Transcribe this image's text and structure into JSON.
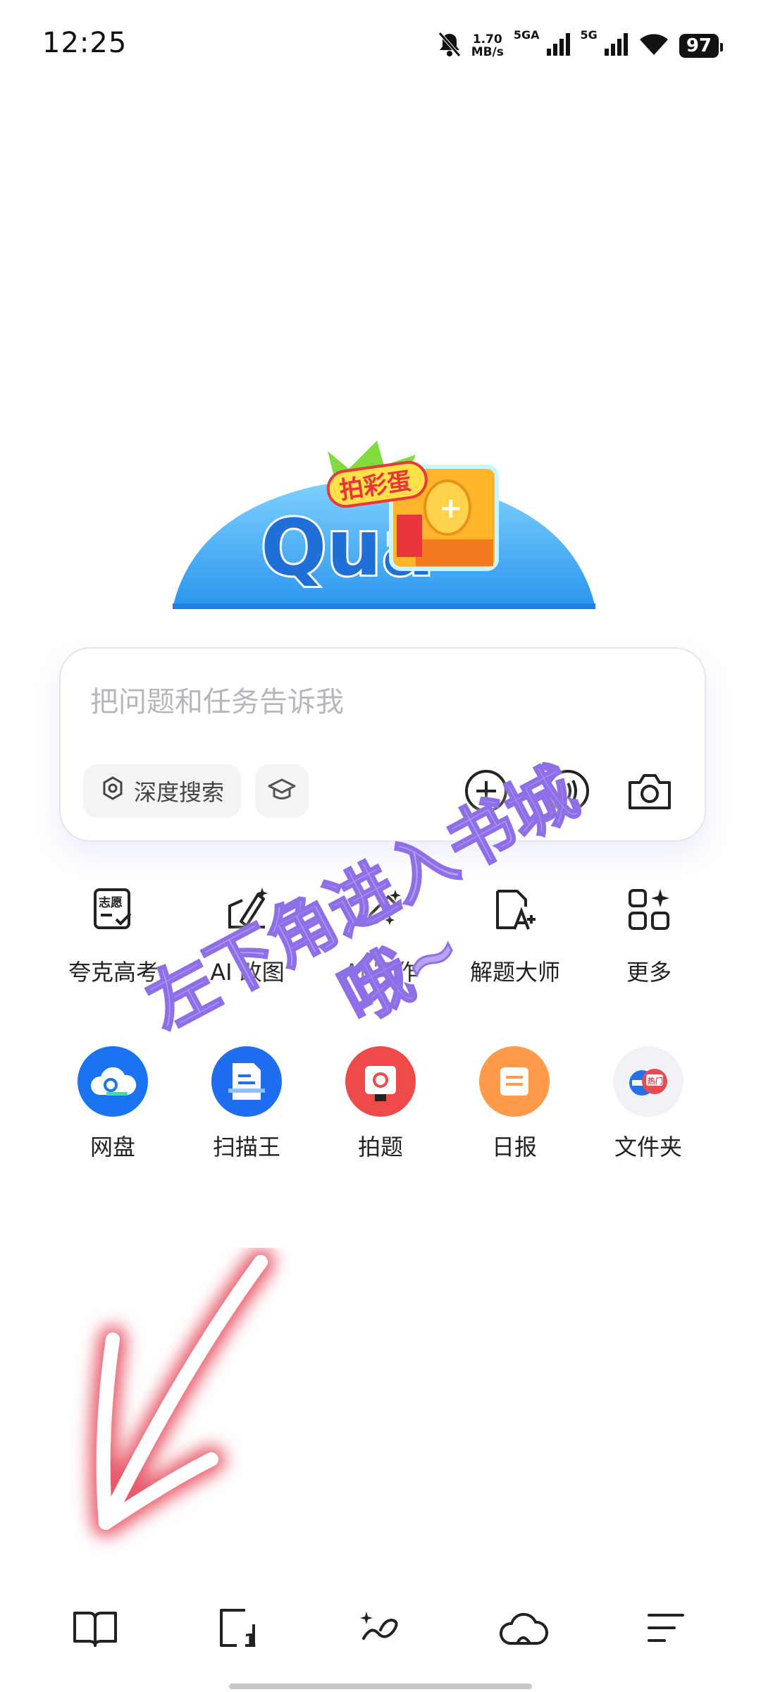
{
  "status_bar": {
    "time": "12:25",
    "net_speed_value": "1.70",
    "net_speed_unit": "MB/s",
    "sim1_label": "5GA",
    "sim2_label": "5G",
    "battery": "97"
  },
  "logo": {
    "brand_text": "Qua",
    "badge_text": "拍彩蛋"
  },
  "search": {
    "placeholder": "把问题和任务告诉我",
    "deep_search_label": "深度搜索"
  },
  "shortcuts": [
    {
      "label": "夸克高考",
      "icon": "volunteer-form-icon",
      "badge": "志愿"
    },
    {
      "label": "AI 改图",
      "icon": "ai-edit-image-icon"
    },
    {
      "label": "AI 写作",
      "icon": "ai-writing-icon"
    },
    {
      "label": "解题大师",
      "icon": "problem-solver-icon"
    },
    {
      "label": "更多",
      "icon": "more-apps-icon"
    }
  ],
  "apps": [
    {
      "label": "网盘",
      "icon": "cloud-drive-icon"
    },
    {
      "label": "扫描王",
      "icon": "scanner-icon"
    },
    {
      "label": "拍题",
      "icon": "photo-question-icon"
    },
    {
      "label": "日报",
      "icon": "daily-news-icon"
    },
    {
      "label": "文件夹",
      "icon": "folder-icon",
      "badge": "热门"
    }
  ],
  "overlay": {
    "line1": "左下角进入书城",
    "line2": "哦~"
  },
  "bottom_nav": [
    {
      "name": "bookstore",
      "icon": "open-book-icon"
    },
    {
      "name": "tabs",
      "icon": "tabs-icon",
      "count": "1"
    },
    {
      "name": "ai-assistant",
      "icon": "sparkle-loop-icon"
    },
    {
      "name": "cloud",
      "icon": "cloud-icon"
    },
    {
      "name": "menu",
      "icon": "menu-icon"
    }
  ],
  "colors": {
    "logo_blue": "#3aa9f5",
    "annotation_purple": "#b9a3f5",
    "arrow_red": "#e85a6a"
  }
}
